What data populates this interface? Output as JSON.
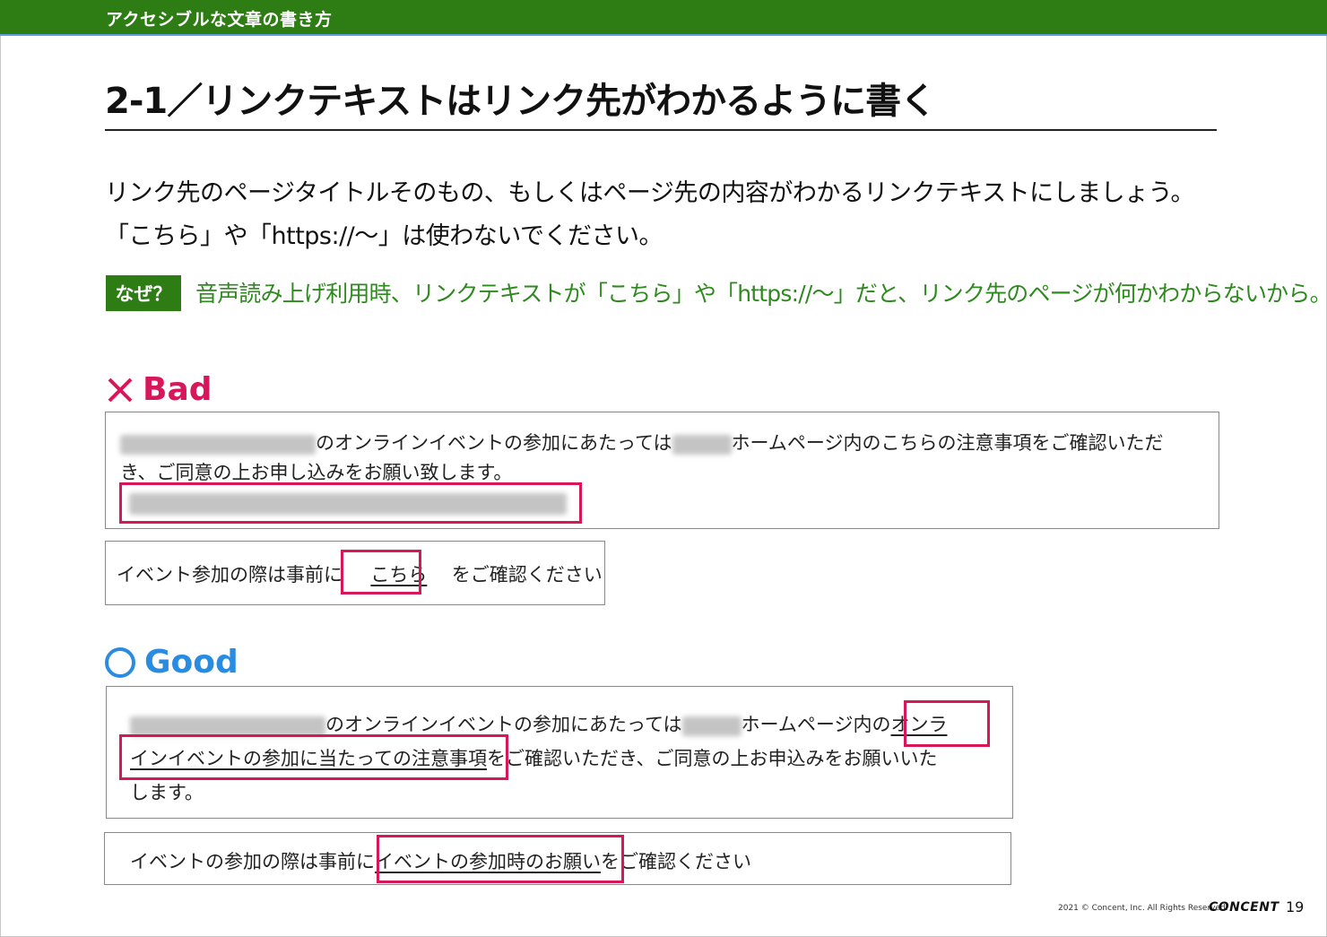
{
  "header": {
    "title": "アクセシブルな文章の書き方"
  },
  "page_title": "2-1／リンクテキストはリンク先がわかるように書く",
  "intro": {
    "line1": "リンク先のページタイトルそのもの、もしくはページ先の内容がわかるリンクテキストにしましょう。",
    "line2": "「こちら」や「https://～」は使わないでください。"
  },
  "why": {
    "badge": "なぜ？",
    "text": "音声読み上げ利用時、リンクテキストが「こちら」や「https://～」だと、リンク先のページが何かわからないから。"
  },
  "bad": {
    "heading": "Bad",
    "example1": {
      "line1_mid": "のオンラインイベントの参加にあたっては",
      "line1_end": "ホームページ内のこちらの注意事項をご確認いただ",
      "line2": "き、ご同意の上お申し込みをお願い致します。"
    },
    "example2": {
      "before": "イベント参加の際は事前に",
      "link": "こちら",
      "after": "をご確認ください"
    }
  },
  "good": {
    "heading": "Good",
    "example1": {
      "line1_mid": "のオンラインイベントの参加にあたっては",
      "line1_end": "ホームページ内の",
      "link_part1": "オンラ",
      "link_part2": "インイベントの参加に当たっての注意事項",
      "line2_after": "をご確認いただき、ご同意の上お申込みをお願いいた",
      "line3": "します。"
    },
    "example2": {
      "before": "イベントの参加の際は事前に",
      "link": "イベントの参加時のお願い",
      "after": "をご確認ください"
    }
  },
  "footer": {
    "copyright": "2021 © Concent, Inc. All Rights Reserved.",
    "brand": "CONCENT",
    "page": "19"
  },
  "colors": {
    "green": "#2e7d14",
    "bad": "#d8175a",
    "good": "#2a8ce0"
  }
}
